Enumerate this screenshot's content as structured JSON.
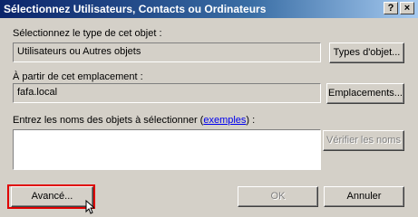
{
  "window": {
    "title": "Sélectionnez Utilisateurs, Contacts ou Ordinateurs",
    "help_button": "?",
    "close_button": "×"
  },
  "object_type": {
    "label": "Sélectionnez le type de cet objet :",
    "value": "Utilisateurs ou Autres objets",
    "button": "Types d'objet..."
  },
  "location": {
    "label": "À partir de cet emplacement :",
    "value": "fafa.local",
    "button": "Emplacements..."
  },
  "names": {
    "label_prefix": "Entrez les noms des objets à sélectionner (",
    "link": "exemples",
    "label_suffix": ") :",
    "value": "",
    "check_button": "Vérifier les noms"
  },
  "footer": {
    "advanced_button": "Avancé...",
    "ok_button": "OK",
    "cancel_button": "Annuler"
  },
  "colors": {
    "highlight": "#e00000",
    "title_bar": "#0a246a",
    "link": "#0000ee"
  }
}
